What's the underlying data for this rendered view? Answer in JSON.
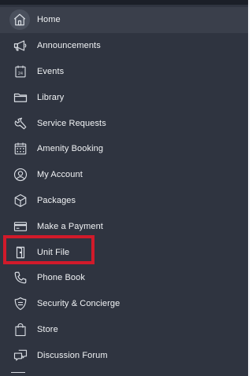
{
  "menu": {
    "items": [
      {
        "label": "Home",
        "icon": "home-icon"
      },
      {
        "label": "Announcements",
        "icon": "megaphone-icon"
      },
      {
        "label": "Events",
        "icon": "calendar-event-icon"
      },
      {
        "label": "Library",
        "icon": "folder-icon"
      },
      {
        "label": "Service Requests",
        "icon": "wrench-icon"
      },
      {
        "label": "Amenity Booking",
        "icon": "calendar-grid-icon"
      },
      {
        "label": "My Account",
        "icon": "user-icon"
      },
      {
        "label": "Packages",
        "icon": "package-icon"
      },
      {
        "label": "Make a Payment",
        "icon": "credit-card-icon"
      },
      {
        "label": "Unit File",
        "icon": "door-icon"
      },
      {
        "label": "Phone Book",
        "icon": "phone-icon"
      },
      {
        "label": "Security & Concierge",
        "icon": "shield-icon"
      },
      {
        "label": "Store",
        "icon": "shopping-bag-icon"
      },
      {
        "label": "Discussion Forum",
        "icon": "chat-icon"
      }
    ],
    "active_item": "Home",
    "highlighted_item": "Unit File"
  },
  "icon_glyphs": {
    "calendar_day": "24"
  },
  "colors": {
    "background": "#2f3440",
    "text": "#f1f3f5",
    "icon_stroke": "#d9dde3",
    "highlight_border": "#d11a2a"
  }
}
